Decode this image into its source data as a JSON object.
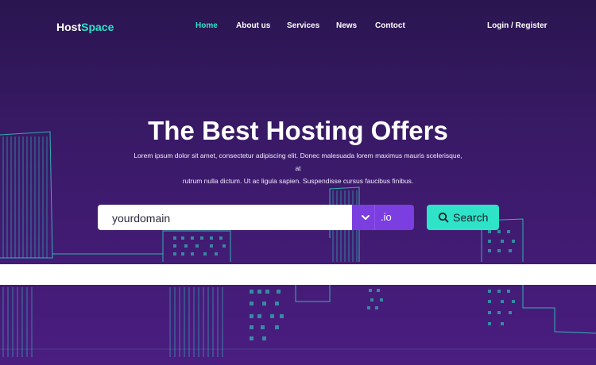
{
  "brand": {
    "part1": "Host",
    "part2": "Space"
  },
  "nav": {
    "home": "Home",
    "about": "About us",
    "services": "Services",
    "news": "News",
    "contact": "Contoct",
    "login": "Login / Register"
  },
  "hero": {
    "title": "The Best Hosting Offers",
    "subtitle_line1": "Lorem ipsum dolor sit amet, consectetur adipiscing elit. Donec malesuada lorem maximus mauris scelerisque, at",
    "subtitle_line2": "rutrum nulla dictum. Ut ac ligula sapien. Suspendisse cursus faucibus finibus."
  },
  "search": {
    "value": "yourdomain",
    "tld": ".io",
    "button_label": "Search"
  },
  "colors": {
    "accent": "#2ee3c7",
    "tld_bg": "#7b3ee0",
    "bg_top": "#2a1550",
    "bg_bottom": "#4a1d80"
  },
  "icons": {
    "tld_dropdown": "chevron-down-icon",
    "search": "search-icon"
  }
}
